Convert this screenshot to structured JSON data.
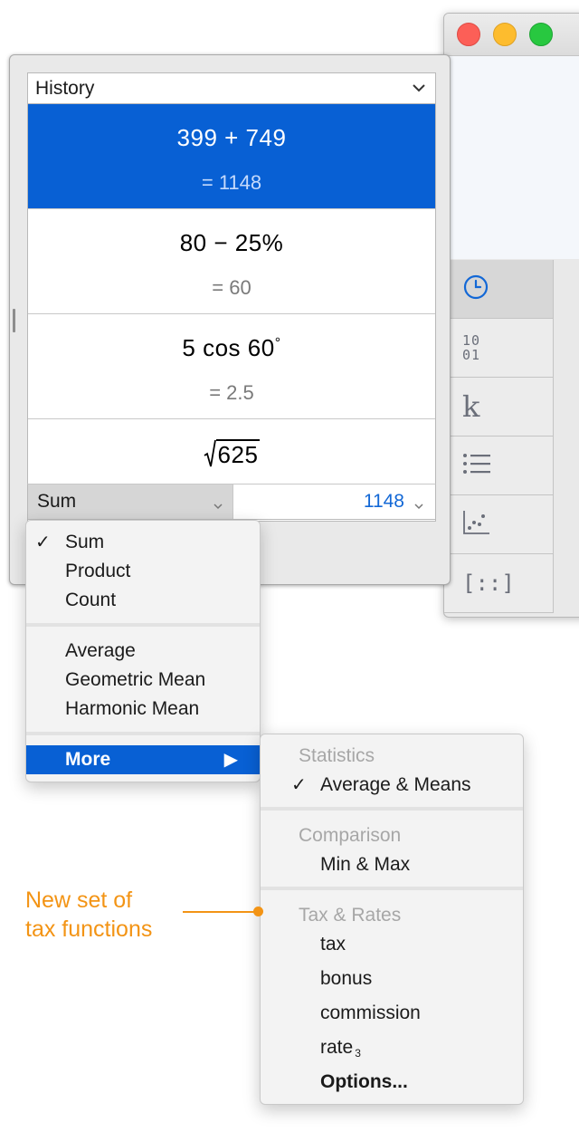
{
  "history": {
    "header": "History",
    "entries": [
      {
        "expression": "399 + 749",
        "result": "= 1148",
        "selected": true
      },
      {
        "expression": "80 − 25%",
        "result": "= 60",
        "selected": false
      },
      {
        "expression": "5 cos 60",
        "degree_mark": "°",
        "result": "= 2.5",
        "selected": false
      },
      {
        "expression_radicand": "625",
        "selected": false
      }
    ],
    "footer": {
      "function_label": "Sum",
      "value": "1148"
    }
  },
  "function_menu": {
    "items": [
      {
        "label": "Sum",
        "checked": true
      },
      {
        "label": "Product",
        "checked": false
      },
      {
        "label": "Count",
        "checked": false
      },
      {
        "label": "Average",
        "checked": false
      },
      {
        "label": "Geometric Mean",
        "checked": false
      },
      {
        "label": "Harmonic Mean",
        "checked": false
      }
    ],
    "more_label": "More",
    "check_glyph": "✓",
    "arrow_glyph": "▶"
  },
  "more_submenu": {
    "sections": [
      {
        "title": "Statistics",
        "items": [
          {
            "label": "Average & Means",
            "checked": true
          }
        ]
      },
      {
        "title": "Comparison",
        "items": [
          {
            "label": "Min & Max",
            "checked": false
          }
        ]
      },
      {
        "title": "Tax & Rates",
        "items": [
          {
            "label": "tax"
          },
          {
            "label": "bonus"
          },
          {
            "label": "commission"
          },
          {
            "label": "rate",
            "subscript": "3"
          },
          {
            "label": "Options...",
            "bold": true
          }
        ]
      }
    ]
  },
  "toolbar": {
    "icons": [
      "clock-icon",
      "binary-icon",
      "constants-icon",
      "list-icon",
      "scatter-plot-icon",
      "matrix-icon"
    ],
    "binary_top": "10",
    "binary_bottom": "01",
    "constants_glyph": "k",
    "matrix_glyph": "[::]"
  },
  "annotation": {
    "line1": "New set of",
    "line2": "tax functions",
    "color": "#f39415"
  },
  "colors": {
    "selection": "#0860d4",
    "result_value": "#1368d6"
  }
}
